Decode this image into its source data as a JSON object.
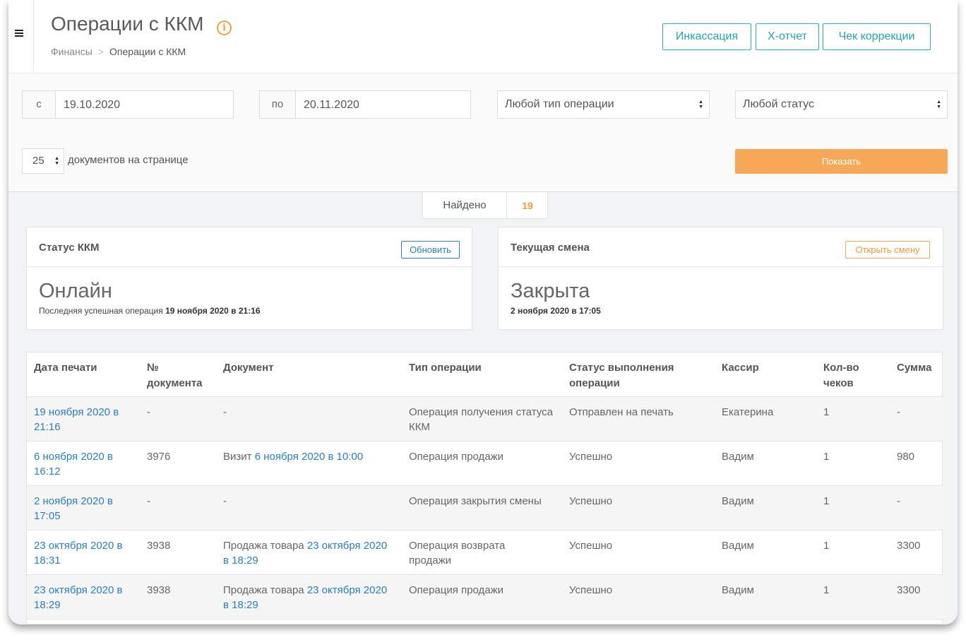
{
  "header": {
    "title": "Операции с ККМ",
    "breadcrumb_root": "Финансы",
    "breadcrumb_sep": ">",
    "breadcrumb_current": "Операции с ККМ",
    "buttons": {
      "incasso": "Инкассация",
      "x_report": "X-отчет",
      "correction": "Чек коррекции"
    }
  },
  "filters": {
    "from_prefix": "с",
    "from_value": "19.10.2020",
    "to_prefix": "по",
    "to_value": "20.11.2020",
    "operation_type": "Любой тип операции",
    "status": "Любой статус",
    "per_page_value": "25",
    "per_page_label": "документов на странице",
    "show_button": "Показать"
  },
  "found": {
    "label": "Найдено",
    "count": "19"
  },
  "status_card": {
    "title": "Статус ККМ",
    "button": "Обновить",
    "state": "Онлайн",
    "sub_prefix": "Последняя успешная операция",
    "sub_date": "19 ноября 2020 в 21:16"
  },
  "shift_card": {
    "title": "Текущая смена",
    "button": "Открыть смену",
    "state": "Закрыта",
    "sub_date": "2 ноября 2020 в 17:05"
  },
  "table": {
    "columns": [
      "Дата печати",
      "№ документа",
      "Документ",
      "Тип операции",
      "Статус выполнения операции",
      "Кассир",
      "Кол-во чеков",
      "Сумма"
    ],
    "rows": [
      {
        "date": "19 ноября 2020 в 21:16",
        "num": "-",
        "doc_prefix": "-",
        "doc_link": "",
        "type": "Операция получения статуса ККМ",
        "status": "Отправлен на печать",
        "cashier": "Екатерина",
        "count": "1",
        "sum": "-"
      },
      {
        "date": "6 ноября 2020 в 16:12",
        "num": "3976",
        "doc_prefix": "Визит",
        "doc_link": "6 ноября 2020 в 10:00",
        "type": "Операция продажи",
        "status": "Успешно",
        "cashier": "Вадим",
        "count": "1",
        "sum": "980"
      },
      {
        "date": "2 ноября 2020 в 17:05",
        "num": "-",
        "doc_prefix": "-",
        "doc_link": "",
        "type": "Операция закрытия смены",
        "status": "Успешно",
        "cashier": "Вадим",
        "count": "1",
        "sum": "-"
      },
      {
        "date": "23 октября 2020 в 18:31",
        "num": "3938",
        "doc_prefix": "Продажа товара",
        "doc_link": "23 октября 2020 в 18:29",
        "type": "Операция возврата продажи",
        "status": "Успешно",
        "cashier": "Вадим",
        "count": "1",
        "sum": "3300"
      },
      {
        "date": "23 октября 2020 в 18:29",
        "num": "3938",
        "doc_prefix": "Продажа товара",
        "doc_link": "23 октября 2020 в 18:29",
        "type": "Операция продажи",
        "status": "Успешно",
        "cashier": "Вадим",
        "count": "1",
        "sum": "3300"
      }
    ]
  },
  "colors": {
    "accent_teal": "#27b3b8",
    "accent_orange": "#f6a857",
    "link_blue": "#2a7fc0",
    "update_blue": "#2a7fc0"
  }
}
